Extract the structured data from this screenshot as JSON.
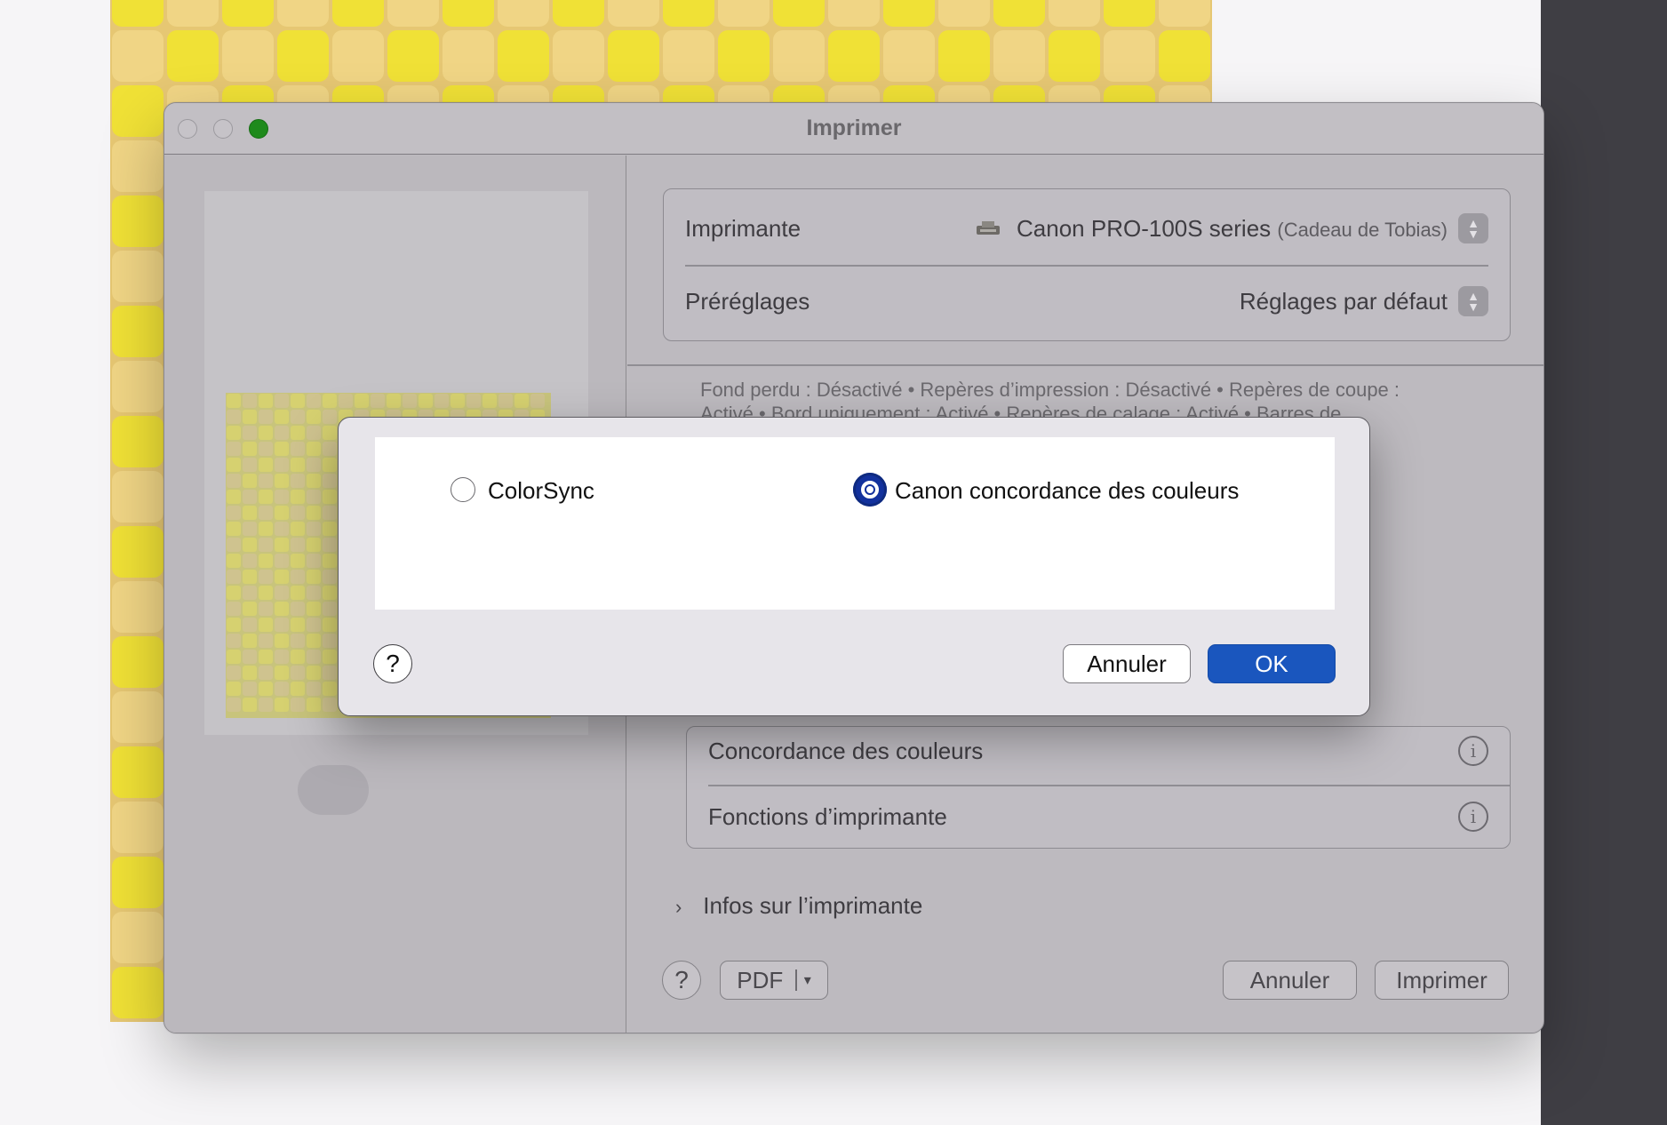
{
  "window": {
    "title": "Imprimer"
  },
  "printer_settings": {
    "printer_label": "Imprimante",
    "printer_name": "Canon PRO-100S series",
    "printer_owner": "(Cadeau de Tobias)",
    "printer_icon": "printer-icon",
    "presets_label": "Préréglages",
    "presets_value": "Réglages par défaut",
    "summary_line_1": "Fond perdu : Désactivé • Repères d’impression : Désactivé • Repères de coupe :",
    "summary_line_2": "Activé • Bord uniquement : Activé • Repères de calage : Activé • Barres de"
  },
  "sections": [
    {
      "label": "Concordance des couleurs",
      "icon": "info-icon"
    },
    {
      "label": "Fonctions d’imprimante",
      "icon": "info-icon"
    }
  ],
  "printer_info": {
    "label": "Infos sur l’imprimante"
  },
  "footer": {
    "help": "?",
    "pdf_label": "PDF",
    "cancel_label": "Annuler",
    "print_label": "Imprimer"
  },
  "color_sheet": {
    "options": [
      {
        "label": "ColorSync",
        "selected": false
      },
      {
        "label": "Canon concordance des couleurs",
        "selected": true
      }
    ],
    "help": "?",
    "cancel_label": "Annuler",
    "ok_label": "OK"
  },
  "colors": {
    "accent": "#1a56be",
    "tile_yellow": "#f0e136",
    "tile_tan": "#f0d585",
    "zoom_green": "#1f8a1c"
  }
}
